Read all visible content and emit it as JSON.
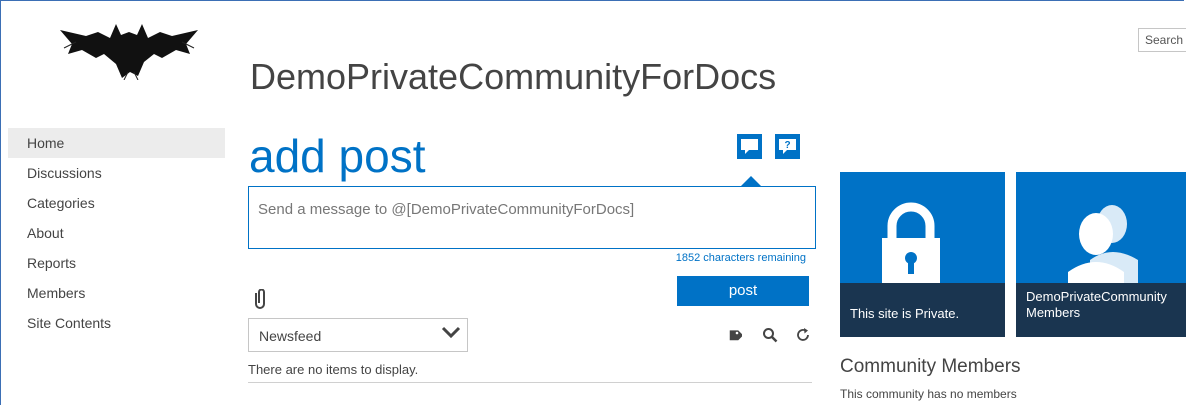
{
  "header": {
    "site_title": "DemoPrivateCommunityForDocs",
    "search_placeholder": "Search"
  },
  "nav": {
    "items": [
      {
        "label": "Home",
        "selected": true
      },
      {
        "label": "Discussions"
      },
      {
        "label": "Categories"
      },
      {
        "label": "About"
      },
      {
        "label": "Reports"
      },
      {
        "label": "Members"
      },
      {
        "label": "Site Contents"
      }
    ]
  },
  "composer": {
    "heading": "add post",
    "placeholder": "Send a message to @[DemoPrivateCommunityForDocs]",
    "chars_remaining": "1852 characters remaining",
    "post_label": "post",
    "icons": [
      "comment-icon",
      "question-icon",
      "paperclip-icon"
    ]
  },
  "feed": {
    "selected": "Newsfeed",
    "empty_message": "There are no items to display.",
    "icons": [
      "tag-icon",
      "search-icon",
      "refresh-icon"
    ]
  },
  "tiles": {
    "private_caption": "This site is Private.",
    "members_caption_line1": "DemoPrivateCommunity",
    "members_caption_line2": "Members"
  },
  "community": {
    "heading": "Community Members",
    "empty_message": "This community has no members"
  },
  "colors": {
    "accent": "#0072c6",
    "tile_caption": "#1a3550"
  }
}
